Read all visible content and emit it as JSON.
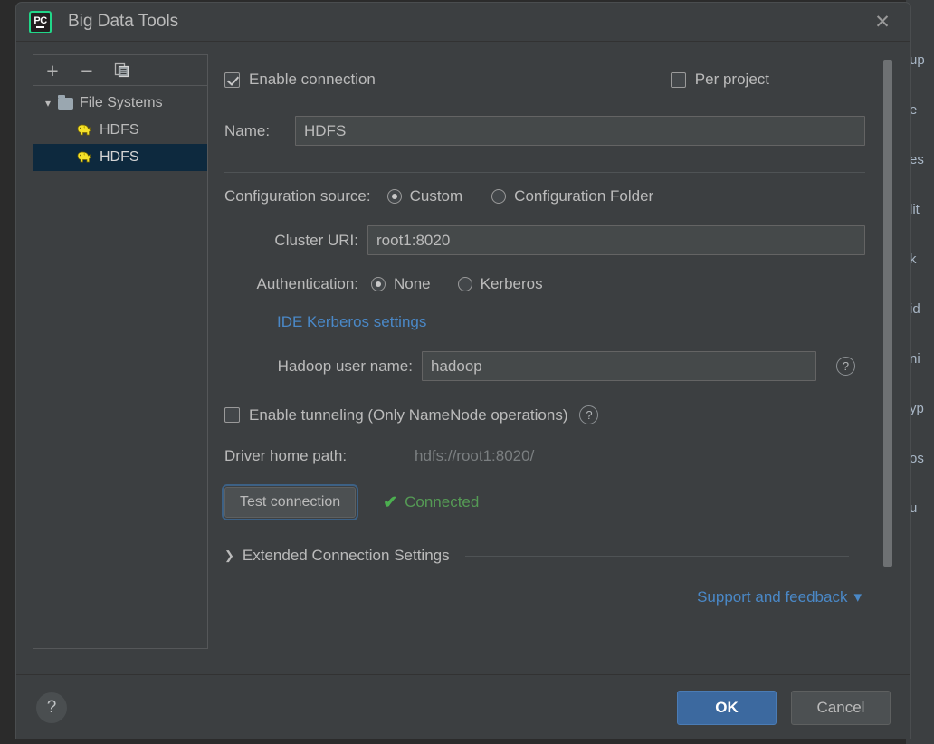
{
  "window": {
    "title": "Big Data Tools",
    "logo_text": "PC",
    "close_icon": "close-icon"
  },
  "sidebar": {
    "toolbar": {
      "add_label": "+",
      "remove_label": "−",
      "copy_icon": "copy-icon"
    },
    "tree": [
      {
        "label": "File Systems",
        "type": "folder",
        "expanded": true,
        "selected": false
      },
      {
        "label": "HDFS",
        "type": "hdfs",
        "selected": false
      },
      {
        "label": "HDFS",
        "type": "hdfs",
        "selected": true
      }
    ]
  },
  "form": {
    "enable_connection": {
      "label": "Enable connection",
      "checked": true
    },
    "per_project": {
      "label": "Per project",
      "checked": false
    },
    "name": {
      "label": "Name:",
      "value": "HDFS",
      "placeholder": ""
    },
    "configuration_source": {
      "label": "Configuration source:",
      "options": [
        "Custom",
        "Configuration Folder"
      ],
      "selected": "Custom"
    },
    "cluster_uri": {
      "label": "Cluster URI:",
      "value": "root1:8020",
      "placeholder": ""
    },
    "authentication": {
      "label": "Authentication:",
      "options": [
        "None",
        "Kerberos"
      ],
      "selected": "None"
    },
    "kerberos_link": "IDE Kerberos settings",
    "hadoop_user_name": {
      "label": "Hadoop user name:",
      "value": "hadoop",
      "placeholder": "",
      "help_icon": "help-icon"
    },
    "enable_tunneling": {
      "label": "Enable tunneling (Only NameNode operations)",
      "checked": false,
      "help_icon": "help-icon"
    },
    "driver_home_path": {
      "label": "Driver home path:",
      "value": "hdfs://root1:8020/"
    },
    "test_connection": {
      "label": "Test connection",
      "focused": true
    },
    "connection_status": {
      "icon": "checkmark-icon",
      "text": "Connected"
    },
    "extended_settings": {
      "label": "Extended Connection Settings",
      "expanded": false
    },
    "support_link": {
      "label": "Support and feedback",
      "caret": "▾"
    }
  },
  "bottom_bar": {
    "help_label": "?",
    "ok_label": "OK",
    "cancel_label": "Cancel"
  },
  "background": {
    "fragments": [
      "up",
      "e",
      "es",
      "lit",
      "k",
      "id",
      "ni",
      "yp",
      "os",
      "u"
    ]
  },
  "colors": {
    "accent_blue": "#3c699f",
    "link_blue": "#4a88c7",
    "status_green": "#559a55",
    "selection_navy": "#0d293e",
    "logo_green": "#21d789",
    "panel_bg": "#3c3f41"
  }
}
